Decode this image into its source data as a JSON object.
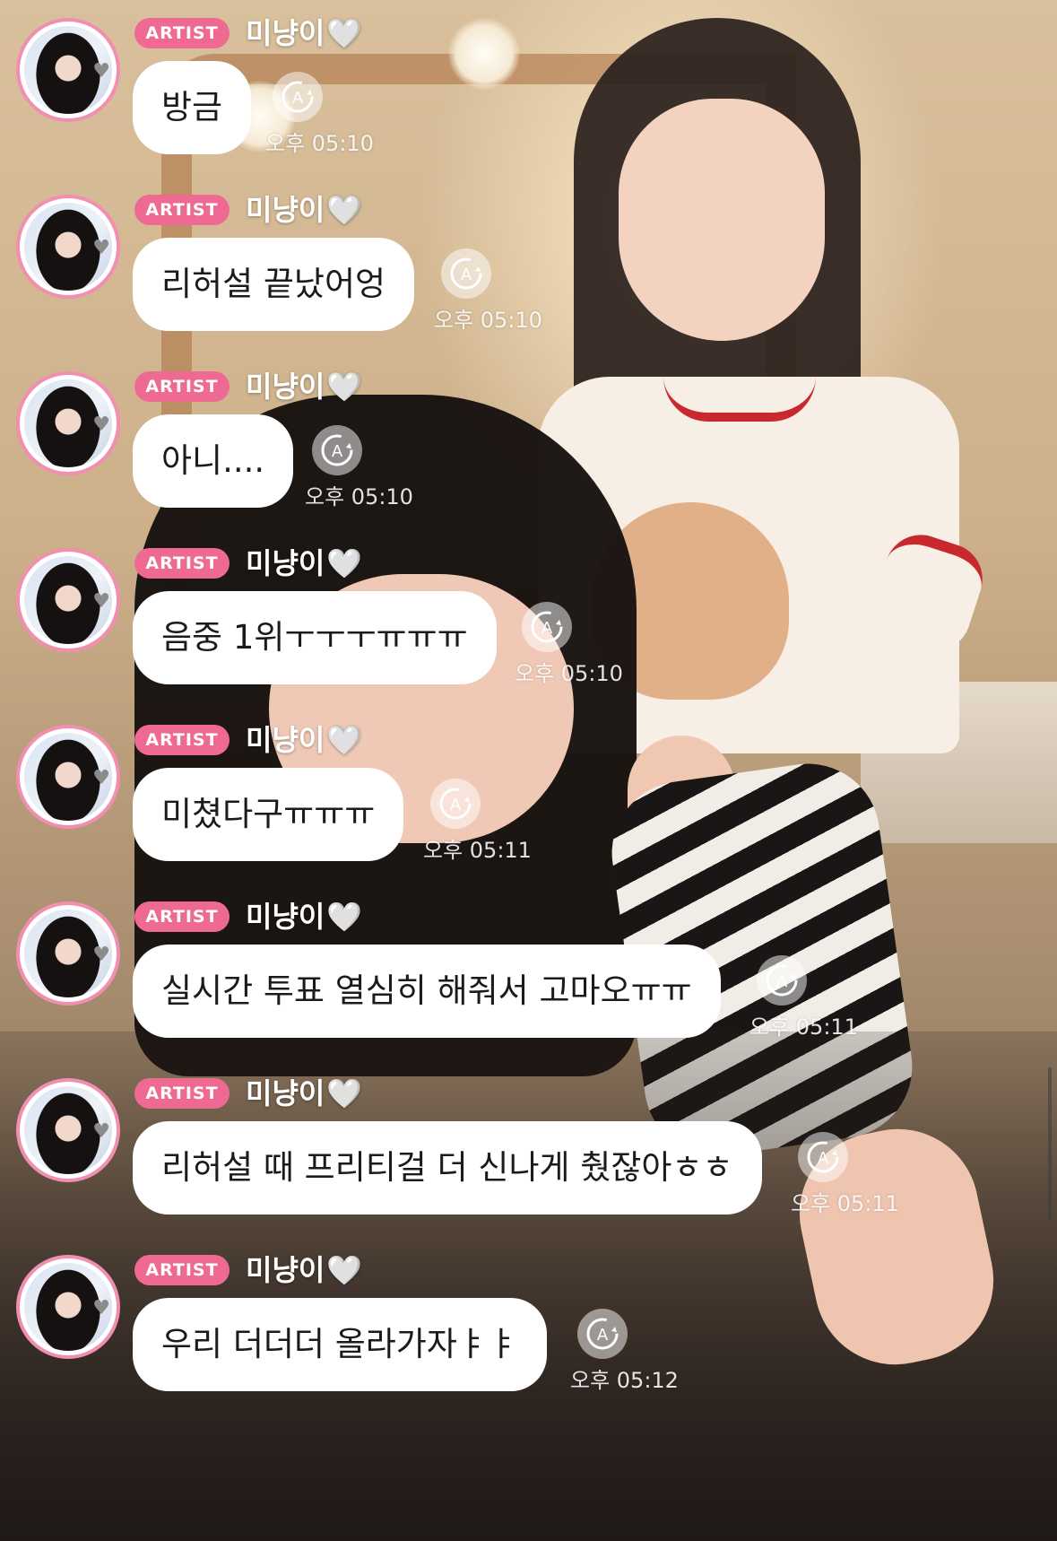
{
  "colors": {
    "badge": "#ef6a93",
    "avatar_ring": "#f08fb0",
    "bubble": "#ffffff",
    "text": "#1b1b1b"
  },
  "messages": [
    {
      "badge": "ARTIST",
      "sender": "미냥이",
      "text": "방금",
      "time": "오후 05:10",
      "icon": "translate-icon"
    },
    {
      "badge": "ARTIST",
      "sender": "미냥이",
      "text": "리허설 끝났어엉",
      "time": "오후 05:10",
      "icon": "translate-icon"
    },
    {
      "badge": "ARTIST",
      "sender": "미냥이",
      "text": "아니....",
      "time": "오후 05:10",
      "icon": "translate-icon"
    },
    {
      "badge": "ARTIST",
      "sender": "미냥이",
      "text": "음중 1위ㅜㅜㅜㅠㅠㅠ",
      "time": "오후 05:10",
      "icon": "translate-icon"
    },
    {
      "badge": "ARTIST",
      "sender": "미냥이",
      "text": "미쳤다구ㅠㅠㅠ",
      "time": "오후 05:11",
      "icon": "translate-icon"
    },
    {
      "badge": "ARTIST",
      "sender": "미냥이",
      "text": "실시간 투표 열심히 해줘서 고마오ㅠㅠ",
      "time": "오후 05:11",
      "icon": "translate-icon"
    },
    {
      "badge": "ARTIST",
      "sender": "미냥이",
      "text": "리허설 때 프리티걸 더 신나게 췄잖아ㅎㅎ",
      "time": "오후 05:11",
      "icon": "translate-icon"
    },
    {
      "badge": "ARTIST",
      "sender": "미냥이",
      "text": "우리 더더더 올라가자ㅑㅑ",
      "time": "오후 05:12",
      "icon": "translate-icon"
    }
  ]
}
